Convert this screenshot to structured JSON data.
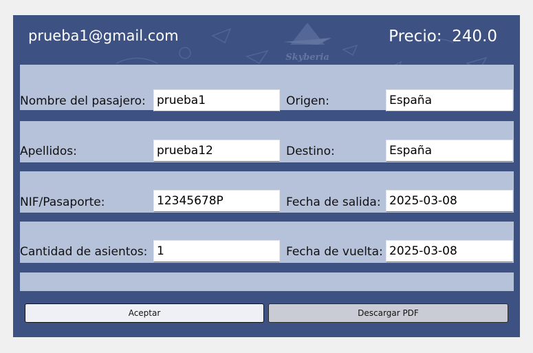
{
  "header": {
    "email": "prueba1@gmail.com",
    "price_label": "Precio:  240.0",
    "logo_text": "Skyberia"
  },
  "form": {
    "nombre": {
      "label": "Nombre del pasajero:",
      "value": "prueba1"
    },
    "apellidos": {
      "label": "Apellidos:",
      "value": "prueba12"
    },
    "nif": {
      "label": "NIF/Pasaporte:",
      "value": "12345678P"
    },
    "asientos": {
      "label": "Cantidad de asientos:",
      "value": "1"
    },
    "origen": {
      "label": "Origen:",
      "value": "España"
    },
    "destino": {
      "label": "Destino:",
      "value": "España"
    },
    "salida": {
      "label": "Fecha de salida:",
      "value": "2025-03-08"
    },
    "vuelta": {
      "label": "Fecha de vuelta:",
      "value": "2025-03-08"
    }
  },
  "buttons": {
    "accept": "Aceptar",
    "pdf": "Descargar PDF"
  },
  "colors": {
    "background": "#3d5283",
    "band": "#b6c1da"
  }
}
